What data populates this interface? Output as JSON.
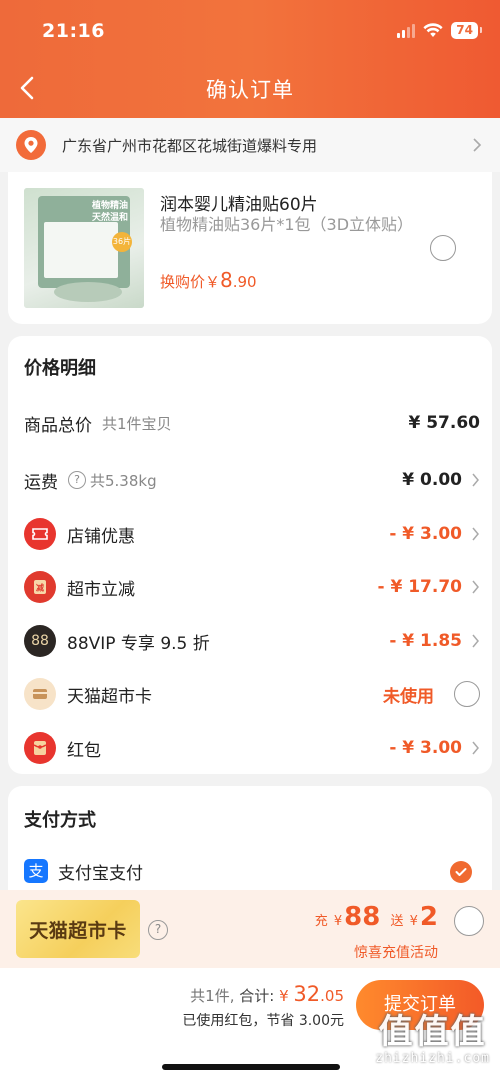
{
  "status_bar": {
    "time": "21:16",
    "battery": "74"
  },
  "nav": {
    "title": "确认订单"
  },
  "address": {
    "text": "广东省广州市花都区花城街道爆料专用"
  },
  "product": {
    "name": "润本婴儿精油贴60片",
    "spec": "植物精油贴36片*1包（3D立体贴）",
    "price_prefix": "换购价￥",
    "price_int": "8",
    "price_dec": ".90",
    "image_text_1": "植物精油",
    "image_text_2": "天然温和",
    "image_badge": "36片"
  },
  "price_details": {
    "title": "价格明细",
    "rows": [
      {
        "label": "商品总价",
        "sub": "共1件宝贝",
        "value": "¥ 57.60"
      },
      {
        "label": "运费",
        "sub": "共5.38kg",
        "value": "¥ 0.00"
      },
      {
        "label": "店铺优惠",
        "value": "- ¥ 3.00"
      },
      {
        "label": "超市立减",
        "value": "- ¥ 17.70"
      },
      {
        "label": "88VIP 专享 9.5 折",
        "value": "- ¥ 1.85",
        "icon_text": "88"
      },
      {
        "label": "天猫超市卡",
        "value": "未使用"
      },
      {
        "label": "红包",
        "value": "- ¥ 3.00"
      }
    ]
  },
  "payment": {
    "title": "支付方式",
    "method": "支付宝支付",
    "icon_text": "支"
  },
  "promo": {
    "card_label": "天猫超市卡",
    "recharge_prefix": "充",
    "recharge_currency": "¥",
    "recharge_amount": "88",
    "gift_prefix": "送",
    "gift_currency": "¥",
    "gift_amount": "2",
    "subtitle": "惊喜充值活动"
  },
  "footer": {
    "count": "共1件,",
    "total_label": "合计:",
    "total_currency": "¥ ",
    "total_int": "32",
    "total_dec": ".05",
    "saved_text": "已使用红包，节省 3.00元",
    "submit_label": "提交订单"
  },
  "watermark": {
    "logo": "值值值",
    "site": "zhizhizhi.com"
  },
  "colors": {
    "accent": "#f05a28",
    "header": "#ee6a3a",
    "alipay": "#1677ff"
  }
}
